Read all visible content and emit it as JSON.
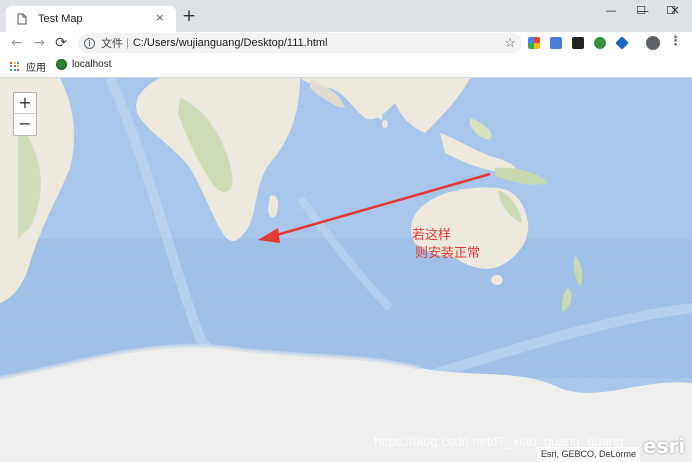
{
  "browser": {
    "tab_title": "Test Map",
    "tab_close": "×",
    "new_tab": "+",
    "minimize": "—",
    "maximize": "☐",
    "close": "✕",
    "back": "←",
    "forward": "→",
    "reload": "⟳",
    "address_prefix": "文件",
    "address_url": "C:/Users/wujianguang/Desktop/111.html",
    "bookmark_star": "☆",
    "menu": "⋮"
  },
  "bookmarks": [
    {
      "label": "应用"
    },
    {
      "label": "localhost"
    }
  ],
  "map": {
    "zoom_in": "+",
    "zoom_out": "−",
    "annotation_line1": "若这样",
    "annotation_line2": "则安装正常",
    "watermark": "https://blog.csdn.net/IT_xiao_guang_guang",
    "attribution": "Esri, GEBCO, DeLorme",
    "logo": "esri"
  },
  "icons": {
    "page": "page-icon",
    "info": "info-icon",
    "apps": "apps-grid-icon",
    "localhost": "globe-icon"
  },
  "colors": {
    "ocean": "#a9c7ea",
    "land": "#ede9df",
    "annotation": "#e53935"
  }
}
